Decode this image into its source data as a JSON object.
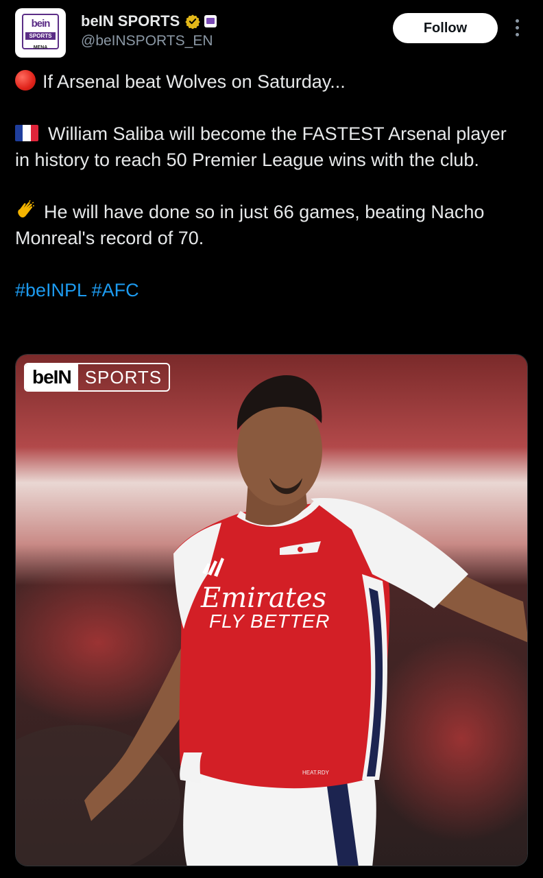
{
  "account": {
    "display_name": "beIN SPORTS",
    "handle": "@beINSPORTS_EN",
    "avatar": {
      "logo_text": "bein",
      "sports_text": "SPORTS",
      "region_text": "MENA",
      "brand_color": "#5b2d86"
    },
    "verified_icon": "gold-verified-badge-icon",
    "affiliate_icon": "affiliate-badge-icon"
  },
  "actions": {
    "follow_label": "Follow",
    "more_icon": "more-vertical-icon"
  },
  "tweet": {
    "line1_emoji": "red-circle",
    "line1": "If Arsenal beat Wolves on Saturday...",
    "line2_emoji": "france-flag",
    "line2": "William Saliba will become the FASTEST Arsenal player in history to reach 50 Premier League wins with the club.",
    "line3_emoji": "clapping-hands",
    "line3": "He will have done so in just 66 games, beating Nacho Monreal's record of 70.",
    "hashtags": [
      "#beINPL",
      "#AFC"
    ]
  },
  "media": {
    "watermark_bein": "beIN",
    "watermark_sports": "SPORTS",
    "shirt_sponsor_1": "Emirates",
    "shirt_sponsor_2": "FLY BETTER",
    "shirt_tag": "HEAT.RDY",
    "colors": {
      "shirt_red": "#d31f26",
      "sleeve_white": "#f3f3f3",
      "trim_navy": "#1c2450",
      "skin": "#8a5a3e"
    }
  },
  "colors": {
    "background": "#000000",
    "text": "#e7e9ea",
    "secondary": "#8b98a5",
    "link": "#1d9bf0"
  }
}
